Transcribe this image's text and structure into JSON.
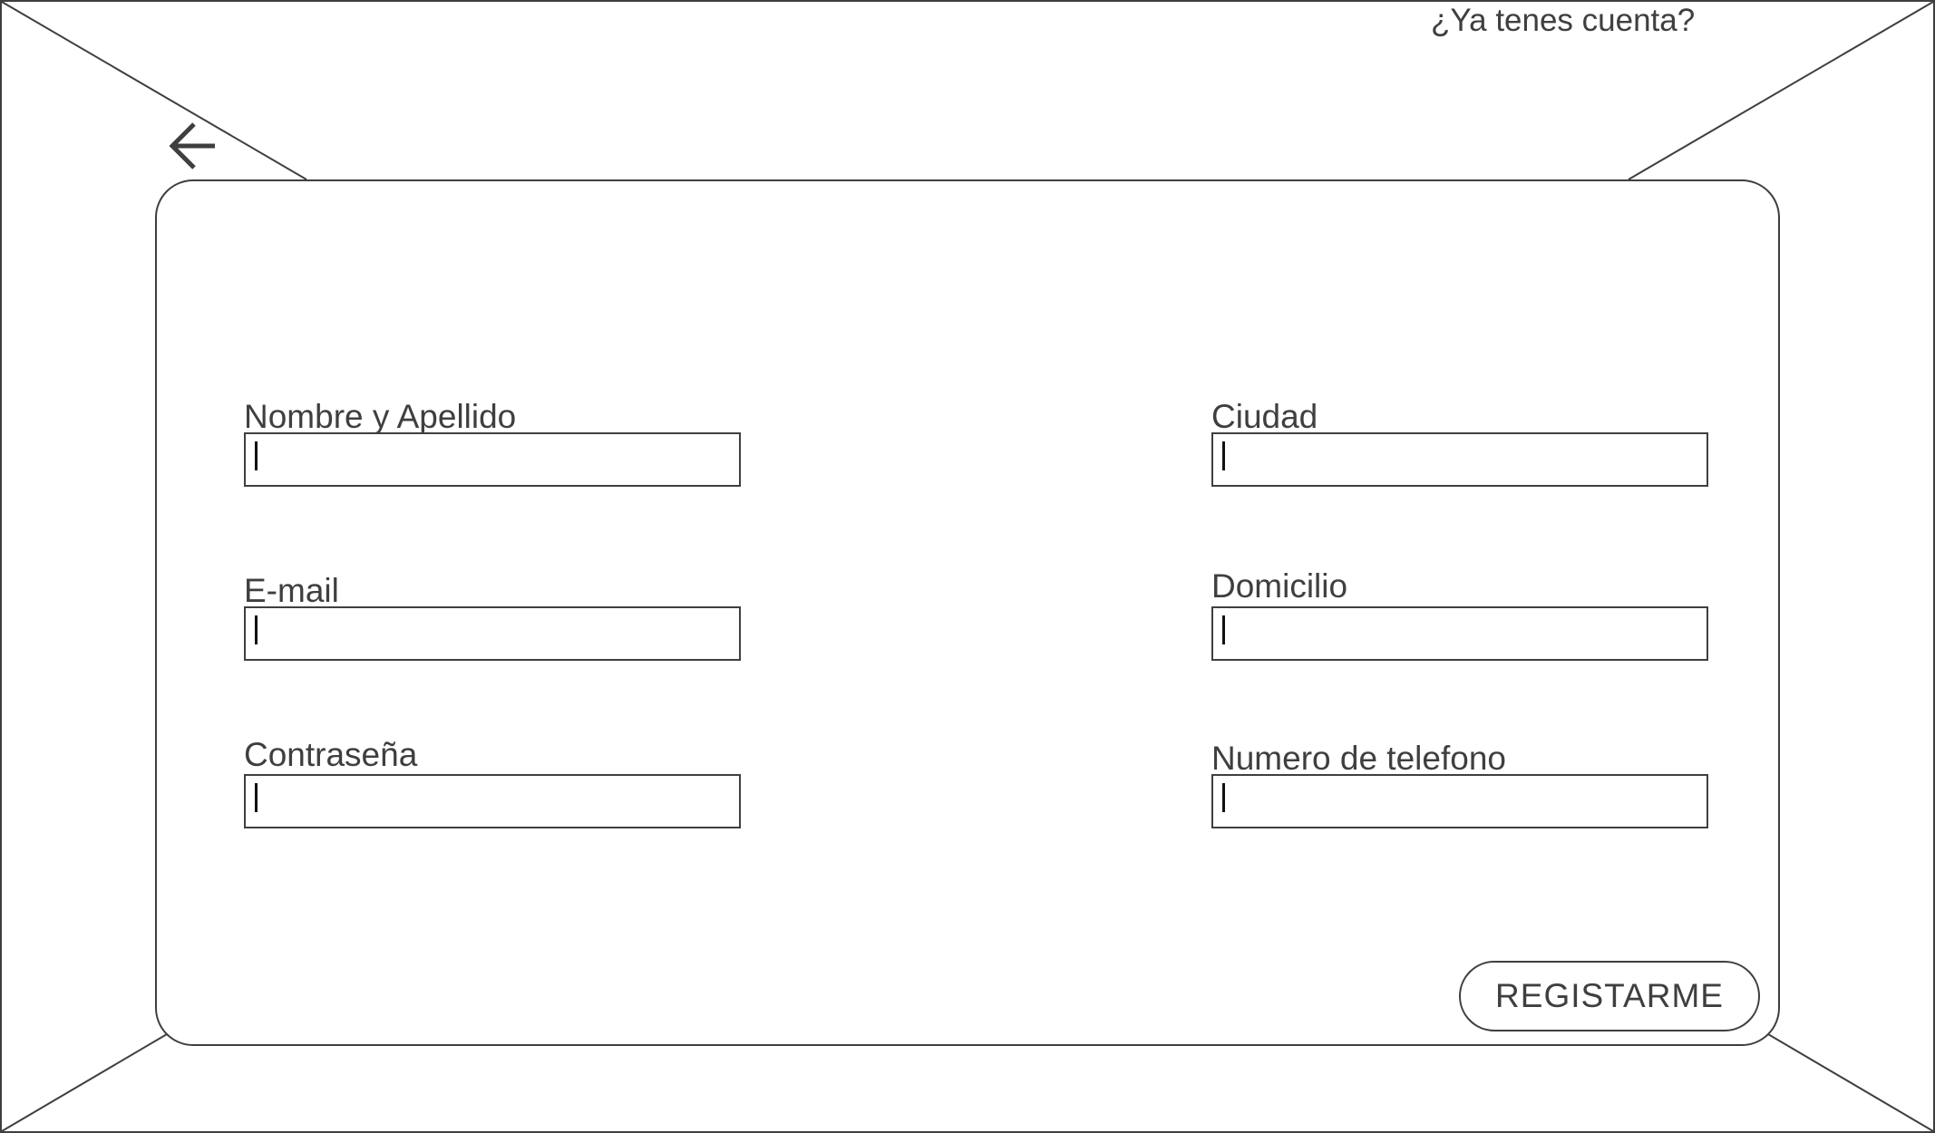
{
  "header": {
    "login_link": "¿Ya tenes cuenta?",
    "back_icon": "arrow-left-icon"
  },
  "form": {
    "fields": [
      {
        "id": "nombre",
        "label": "Nombre y Apellido",
        "value": ""
      },
      {
        "id": "email",
        "label": "E-mail",
        "value": ""
      },
      {
        "id": "password",
        "label": "Contraseña",
        "value": ""
      },
      {
        "id": "ciudad",
        "label": "Ciudad",
        "value": ""
      },
      {
        "id": "domicilio",
        "label": "Domicilio",
        "value": ""
      },
      {
        "id": "telefono",
        "label": "Numero de telefono",
        "value": ""
      }
    ],
    "submit_label": "REGISTARME"
  },
  "colors": {
    "stroke": "#3f3f3f",
    "background": "#ffffff"
  }
}
